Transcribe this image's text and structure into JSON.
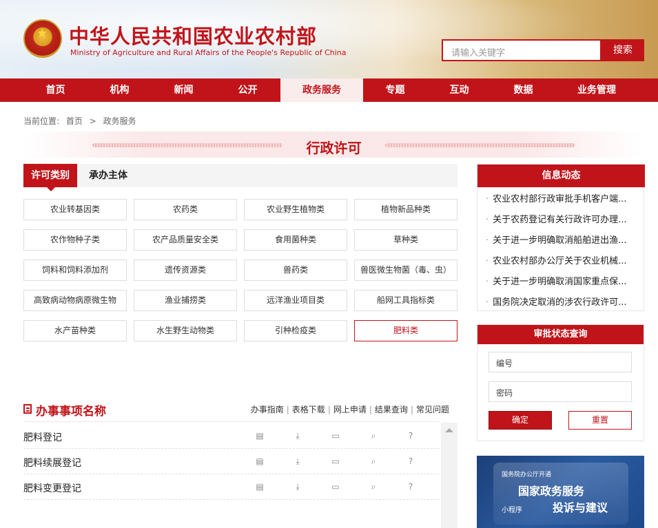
{
  "header": {
    "title": "中华人民共和国农业农村部",
    "subtitle": "Ministry of Agriculture and Rural Affairs of the People's Republic of China",
    "search_placeholder": "请输入关键字",
    "search_button": "搜索"
  },
  "nav": {
    "items": [
      "首页",
      "机构",
      "新闻",
      "公开",
      "政务服务",
      "专题",
      "互动",
      "数据",
      "业务管理"
    ],
    "active": "政务服务"
  },
  "breadcrumb": {
    "label": "当前位置:",
    "home": "首页",
    "sep": ">",
    "current": "政务服务"
  },
  "section_title": "行政许可",
  "tabs": {
    "active": "许可类别",
    "other": "承办主体"
  },
  "categories": [
    "农业转基因类",
    "农药类",
    "农业野生植物类",
    "植物新品种类",
    "农作物种子类",
    "农产品质量安全类",
    "食用菌种类",
    "草种类",
    "饲料和饲料添加剂",
    "遗传资源类",
    "兽药类",
    "兽医微生物菌（毒、虫）",
    "高致病动物病原微生物",
    "渔业捕捞类",
    "远洋渔业项目类",
    "船网工具指标类",
    "水产苗种类",
    "水生野生动物类",
    "引种检疫类",
    "肥料类"
  ],
  "active_category": "肥料类",
  "matters": {
    "title": "办事事项名称",
    "links": [
      "办事指南",
      "表格下载",
      "网上申请",
      "结果查询",
      "常见问题"
    ],
    "rows": [
      "肥料登记",
      "肥料续展登记",
      "肥料变更登记"
    ]
  },
  "news": {
    "title": "信息动态",
    "items": [
      "农业农村部行政审批手机客户端...",
      "关于农药登记有关行政许可办理...",
      "关于进一步明确取消船舶进出渔...",
      "农业农村部办公厅关于农业机械...",
      "关于进一步明确取消国家重点保...",
      "国务院决定取消的涉农行政许可..."
    ]
  },
  "query": {
    "title": "审批状态查询",
    "number_placeholder": "编号",
    "password_placeholder": "密码",
    "ok": "确定",
    "reset": "重置"
  },
  "promo": {
    "small": "国务院办公厅开通",
    "main": "国家政务服务",
    "tag": "小程序",
    "sub": "投诉与建议"
  },
  "colors": {
    "brand_red": "#c1141a",
    "nav_active_bg": "#fbecec"
  }
}
